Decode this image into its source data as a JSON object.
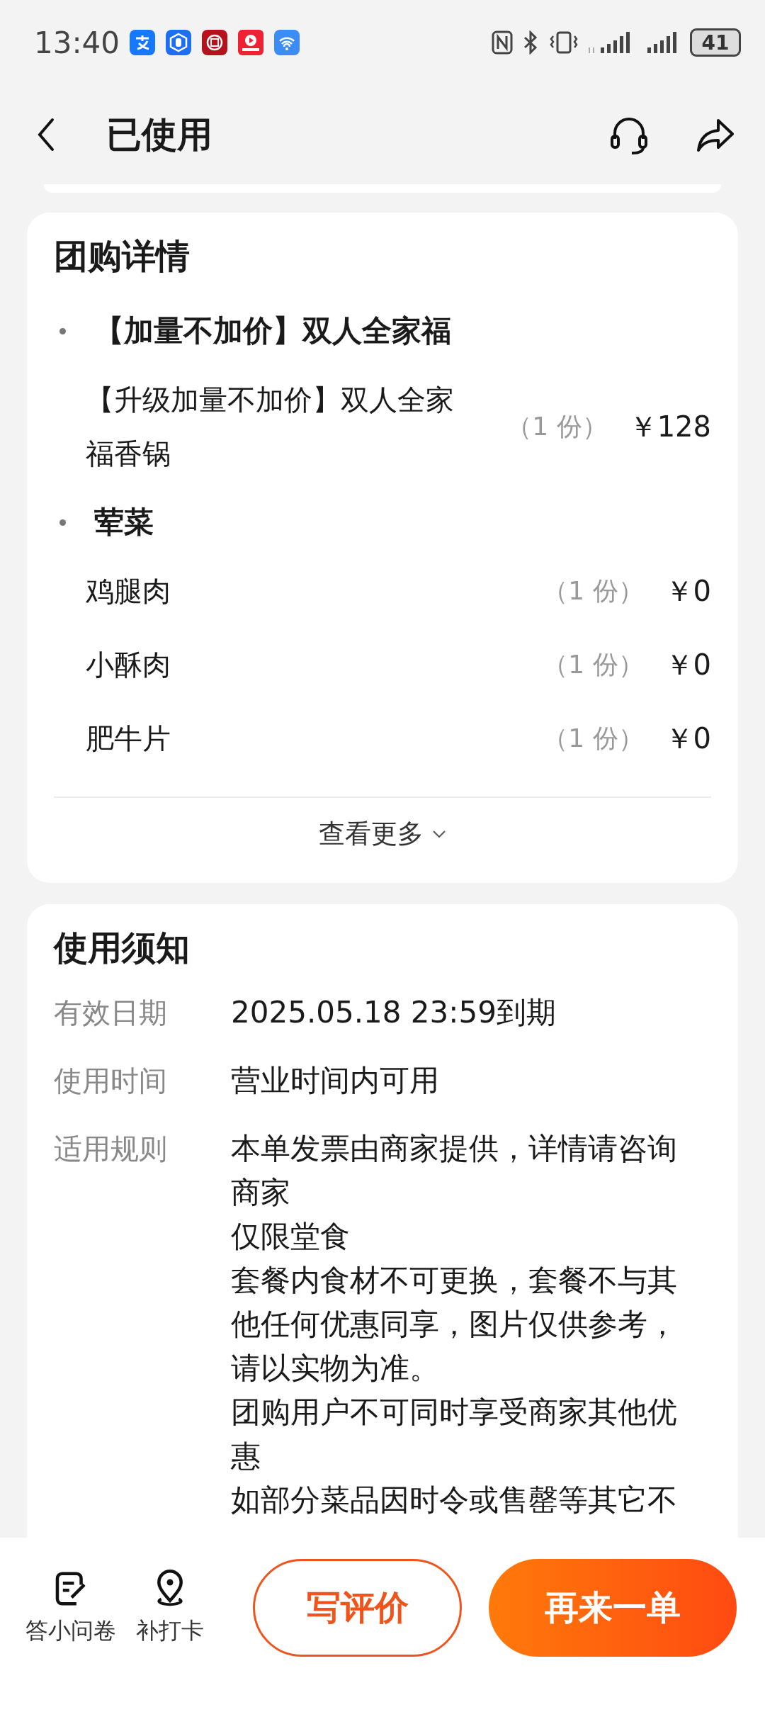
{
  "status_bar": {
    "time": "13:40",
    "battery": "41"
  },
  "header": {
    "title": "已使用"
  },
  "deal_card": {
    "title": "团购详情",
    "groups": [
      {
        "name": "【加量不加价】双人全家福",
        "items": [
          {
            "name": "【升级加量不加价】双人全家福香锅",
            "quantity": "（1 份）",
            "price": "￥128"
          }
        ]
      },
      {
        "name": "荤菜",
        "items": [
          {
            "name": "鸡腿肉",
            "quantity": "（1 份）",
            "price": "￥0"
          },
          {
            "name": "小酥肉",
            "quantity": "（1 份）",
            "price": "￥0"
          },
          {
            "name": "肥牛片",
            "quantity": "（1 份）",
            "price": "￥0"
          }
        ]
      }
    ],
    "more": "查看更多"
  },
  "notice_card": {
    "title": "使用须知",
    "rows": [
      {
        "label": "有效日期",
        "lines": [
          "2025.05.18 23:59到期"
        ]
      },
      {
        "label": "使用时间",
        "lines": [
          "营业时间内可用"
        ]
      },
      {
        "label": "适用规则",
        "lines": [
          "本单发票由商家提供，详情请咨询商家",
          "仅限堂食",
          "套餐内食材不可更换，套餐不与其他任何优惠同享，图片仅供参考，请以实物为准。",
          "团购用户不可同时享受商家其他优惠",
          "如部分菜品因时令或售罄等其它不"
        ]
      }
    ]
  },
  "bottom_bar": {
    "actions": [
      {
        "kind": "survey",
        "label": "答小问卷"
      },
      {
        "kind": "checkin",
        "label": "补打卡"
      }
    ],
    "buttons": [
      {
        "kind": "outline",
        "label": "写评价"
      },
      {
        "kind": "filled",
        "label": "再来一单"
      }
    ]
  }
}
